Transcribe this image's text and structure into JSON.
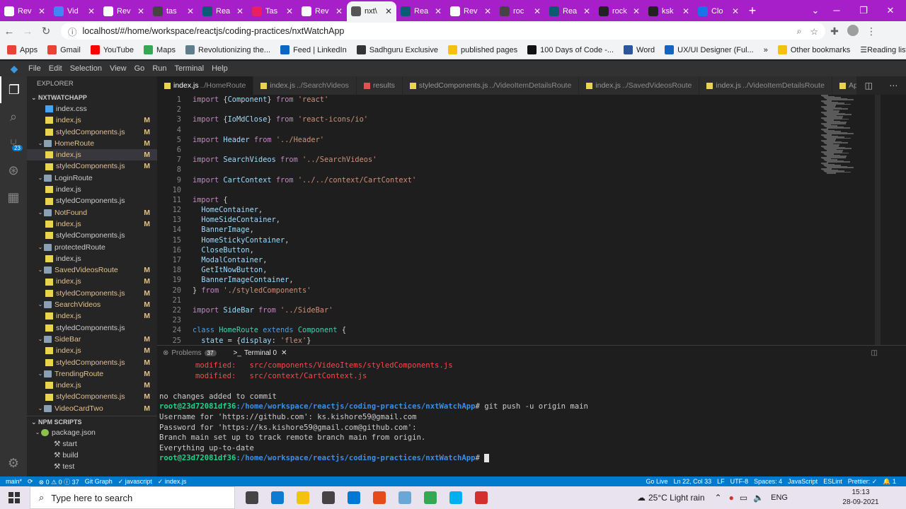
{
  "browser": {
    "tabs": [
      {
        "label": "Rev",
        "color": "#ffffff"
      },
      {
        "label": "Vid",
        "color": "#4285f4"
      },
      {
        "label": "Rev",
        "color": "#ffffff"
      },
      {
        "label": "tas",
        "color": "#444444"
      },
      {
        "label": "Rea",
        "color": "#0b5c73"
      },
      {
        "label": "Tas",
        "color": "#e91e63"
      },
      {
        "label": "Rev",
        "color": "#ffffff"
      },
      {
        "label": "nxt\\",
        "color": "#555555",
        "active": true
      },
      {
        "label": "Rea",
        "color": "#0b5c73"
      },
      {
        "label": "Rev",
        "color": "#ffffff"
      },
      {
        "label": "roc",
        "color": "#444444"
      },
      {
        "label": "Rea",
        "color": "#0b5c73"
      },
      {
        "label": "rock",
        "color": "#222222"
      },
      {
        "label": "ksk",
        "color": "#222222"
      },
      {
        "label": "Clo",
        "color": "#1a73e8"
      }
    ],
    "url": "localhost/#/home/workspace/reactjs/coding-practices/nxtWatchApp",
    "bookmarks": [
      {
        "label": "Apps",
        "color": "#ea4335"
      },
      {
        "label": "Gmail",
        "color": "#ea4335"
      },
      {
        "label": "YouTube",
        "color": "#ff0000"
      },
      {
        "label": "Maps",
        "color": "#34a853"
      },
      {
        "label": "Revolutionizing the...",
        "color": "#607d8b"
      },
      {
        "label": "Feed | LinkedIn",
        "color": "#0a66c2"
      },
      {
        "label": "Sadhguru Exclusive",
        "color": "#333333"
      },
      {
        "label": "published pages",
        "color": "#f4c20d"
      },
      {
        "label": "100 Days of Code -...",
        "color": "#111111"
      },
      {
        "label": "Word",
        "color": "#2b579a"
      },
      {
        "label": "UX/UI Designer (Ful...",
        "color": "#1565c0"
      }
    ],
    "other_bookmarks": "Other bookmarks",
    "reading_list": "Reading list",
    "more": "»"
  },
  "vscode": {
    "menu": [
      "File",
      "Edit",
      "Selection",
      "View",
      "Go",
      "Run",
      "Terminal",
      "Help"
    ],
    "explorer_title": "EXPLORER",
    "project": "NXTWATCHAPP",
    "scm_badge": "23",
    "tree": [
      {
        "label": "index.css",
        "type": "css",
        "indent": 2,
        "m": ""
      },
      {
        "label": "index.js",
        "type": "js",
        "indent": 2,
        "m": "M"
      },
      {
        "label": "styledComponents.js",
        "type": "js",
        "indent": 2,
        "m": "M"
      },
      {
        "label": "HomeRoute",
        "type": "folder",
        "indent": 1,
        "m": "M"
      },
      {
        "label": "index.js",
        "type": "js",
        "indent": 2,
        "m": "M",
        "selected": true
      },
      {
        "label": "styledComponents.js",
        "type": "js",
        "indent": 2,
        "m": "M"
      },
      {
        "label": "LoginRoute",
        "type": "folder",
        "indent": 1,
        "m": ""
      },
      {
        "label": "index.js",
        "type": "js",
        "indent": 2,
        "m": ""
      },
      {
        "label": "styledComponents.js",
        "type": "js",
        "indent": 2,
        "m": ""
      },
      {
        "label": "NotFound",
        "type": "folder",
        "indent": 1,
        "m": "M"
      },
      {
        "label": "index.js",
        "type": "js",
        "indent": 2,
        "m": "M"
      },
      {
        "label": "styledComponents.js",
        "type": "js",
        "indent": 2,
        "m": ""
      },
      {
        "label": "protectedRoute",
        "type": "folder",
        "indent": 1,
        "m": ""
      },
      {
        "label": "index.js",
        "type": "js",
        "indent": 2,
        "m": ""
      },
      {
        "label": "SavedVideosRoute",
        "type": "folder",
        "indent": 1,
        "m": "M"
      },
      {
        "label": "index.js",
        "type": "js",
        "indent": 2,
        "m": "M"
      },
      {
        "label": "styledComponents.js",
        "type": "js",
        "indent": 2,
        "m": "M"
      },
      {
        "label": "SearchVideos",
        "type": "folder",
        "indent": 1,
        "m": "M"
      },
      {
        "label": "index.js",
        "type": "js",
        "indent": 2,
        "m": "M"
      },
      {
        "label": "styledComponents.js",
        "type": "js",
        "indent": 2,
        "m": ""
      },
      {
        "label": "SideBar",
        "type": "folder",
        "indent": 1,
        "m": "M"
      },
      {
        "label": "index.js",
        "type": "js",
        "indent": 2,
        "m": "M"
      },
      {
        "label": "styledComponents.js",
        "type": "js",
        "indent": 2,
        "m": "M"
      },
      {
        "label": "TrendingRoute",
        "type": "folder",
        "indent": 1,
        "m": "M"
      },
      {
        "label": "index.js",
        "type": "js",
        "indent": 2,
        "m": "M"
      },
      {
        "label": "styledComponents.js",
        "type": "js",
        "indent": 2,
        "m": "M"
      },
      {
        "label": "VideoCardTwo",
        "type": "folder",
        "indent": 1,
        "m": "M"
      }
    ],
    "npm_title": "NPM SCRIPTS",
    "npm_pkg": "package.json",
    "npm_scripts": [
      "start",
      "build",
      "test"
    ],
    "editor_tabs": [
      {
        "name": "index.js",
        "path": "../HomeRoute",
        "active": true
      },
      {
        "name": "index.js",
        "path": "../SearchVideos"
      },
      {
        "name": "results",
        "path": ""
      },
      {
        "name": "styledComponents.js",
        "path": "../VideoItemDetailsRoute"
      },
      {
        "name": "index.js",
        "path": "../SavedVideosRoute"
      },
      {
        "name": "index.js",
        "path": "../VideoItemDetailsRoute"
      },
      {
        "name": "Ap",
        "path": ""
      }
    ],
    "code_lines": [
      {
        "n": "1",
        "t": [
          [
            "kw2",
            "import "
          ],
          [
            "pun",
            "{"
          ],
          [
            "var",
            "Component"
          ],
          [
            "pun",
            "} "
          ],
          [
            "kw2",
            "from "
          ],
          [
            "str",
            "'react'"
          ]
        ]
      },
      {
        "n": "2",
        "t": []
      },
      {
        "n": "3",
        "t": [
          [
            "kw2",
            "import "
          ],
          [
            "pun",
            "{"
          ],
          [
            "var",
            "IoMdClose"
          ],
          [
            "pun",
            "} "
          ],
          [
            "kw2",
            "from "
          ],
          [
            "str",
            "'react-icons/io'"
          ]
        ]
      },
      {
        "n": "4",
        "t": []
      },
      {
        "n": "5",
        "t": [
          [
            "kw2",
            "import "
          ],
          [
            "var",
            "Header "
          ],
          [
            "kw2",
            "from "
          ],
          [
            "str",
            "'../Header'"
          ]
        ]
      },
      {
        "n": "6",
        "t": []
      },
      {
        "n": "7",
        "t": [
          [
            "kw2",
            "import "
          ],
          [
            "var",
            "SearchVideos "
          ],
          [
            "kw2",
            "from "
          ],
          [
            "str",
            "'../SearchVideos'"
          ]
        ]
      },
      {
        "n": "8",
        "t": []
      },
      {
        "n": "9",
        "t": [
          [
            "kw2",
            "import "
          ],
          [
            "var",
            "CartContext "
          ],
          [
            "kw2",
            "from "
          ],
          [
            "str",
            "'../../context/CartContext'"
          ]
        ]
      },
      {
        "n": "10",
        "t": []
      },
      {
        "n": "11",
        "t": [
          [
            "kw2",
            "import "
          ],
          [
            "pun",
            "{"
          ]
        ]
      },
      {
        "n": "12",
        "t": [
          [
            "var",
            "  HomeContainer"
          ],
          [
            "pun",
            ","
          ]
        ]
      },
      {
        "n": "13",
        "t": [
          [
            "var",
            "  HomeSideContainer"
          ],
          [
            "pun",
            ","
          ]
        ]
      },
      {
        "n": "14",
        "t": [
          [
            "var",
            "  BannerImage"
          ],
          [
            "pun",
            ","
          ]
        ]
      },
      {
        "n": "15",
        "t": [
          [
            "var",
            "  HomeStickyContainer"
          ],
          [
            "pun",
            ","
          ]
        ]
      },
      {
        "n": "16",
        "t": [
          [
            "var",
            "  CloseButton"
          ],
          [
            "pun",
            ","
          ]
        ]
      },
      {
        "n": "17",
        "t": [
          [
            "var",
            "  ModalContainer"
          ],
          [
            "pun",
            ","
          ]
        ]
      },
      {
        "n": "18",
        "t": [
          [
            "var",
            "  GetItNowButton"
          ],
          [
            "pun",
            ","
          ]
        ]
      },
      {
        "n": "19",
        "t": [
          [
            "var",
            "  BannerImageContainer"
          ],
          [
            "pun",
            ","
          ]
        ]
      },
      {
        "n": "20",
        "t": [
          [
            "pun",
            "} "
          ],
          [
            "kw2",
            "from "
          ],
          [
            "str",
            "'./styledComponents'"
          ]
        ]
      },
      {
        "n": "21",
        "t": []
      },
      {
        "n": "22",
        "t": [
          [
            "kw2",
            "import "
          ],
          [
            "var",
            "SideBar "
          ],
          [
            "kw2",
            "from "
          ],
          [
            "str",
            "'../SideBar'"
          ]
        ]
      },
      {
        "n": "23",
        "t": []
      },
      {
        "n": "24",
        "t": [
          [
            "kw",
            "class "
          ],
          [
            "cls",
            "HomeRoute "
          ],
          [
            "kw",
            "extends "
          ],
          [
            "cls",
            "Component "
          ],
          [
            "pun",
            "{"
          ]
        ]
      },
      {
        "n": "25",
        "t": [
          [
            "var",
            "  state "
          ],
          [
            "pun",
            "= {"
          ],
          [
            "var",
            "display"
          ],
          [
            "pun",
            ": "
          ],
          [
            "str",
            "'flex'"
          ],
          [
            "pun",
            "}"
          ]
        ]
      }
    ],
    "panel_tabs": {
      "problems": "Problems",
      "problems_count": "37",
      "terminal": "Terminal 0"
    },
    "terminal_lines": [
      {
        "kind": "red",
        "text": "        modified:   src/components/VideoItems/styledComponents.js"
      },
      {
        "kind": "red",
        "text": "        modified:   src/context/CartContext.js"
      },
      {
        "kind": "plain",
        "text": ""
      },
      {
        "kind": "plain",
        "text": "no changes added to commit"
      },
      {
        "kind": "prompt",
        "user": "root@23d72081df36",
        "path": ":/home/workspace/reactjs/coding-practices/nxtWatchApp",
        "cmd": "# git push -u origin main"
      },
      {
        "kind": "plain",
        "text": "Username for 'https://github.com': ks.kishore59@gmail.com"
      },
      {
        "kind": "plain",
        "text": "Password for 'https://ks.kishore59@gmail.com@github.com':"
      },
      {
        "kind": "plain",
        "text": "Branch main set up to track remote branch main from origin."
      },
      {
        "kind": "plain",
        "text": "Everything up-to-date"
      },
      {
        "kind": "prompt",
        "user": "root@23d72081df36",
        "path": ":/home/workspace/reactjs/coding-practices/nxtWatchApp",
        "cmd": "# ",
        "cursor": true
      }
    ],
    "status_left": [
      "main*",
      "⟳",
      "⊗ 0 ⚠ 0 ⓘ 37",
      "Git Graph",
      "✓ javascript",
      "✓ index.js"
    ],
    "status_right": [
      "Go Live",
      "Ln 22, Col 33",
      "LF",
      "UTF-8",
      "Spaces: 4",
      "JavaScript",
      "ESLint",
      "Prettier: ✓",
      "🔔 1"
    ]
  },
  "taskbar": {
    "search_placeholder": "Type here to search",
    "weather": "25°C  Light rain",
    "lang": "ENG",
    "time": "15:13",
    "date": "28-09-2021",
    "apps": [
      {
        "name": "task-view-icon",
        "color": "#444444"
      },
      {
        "name": "edge-icon",
        "color": "#0c7bd1"
      },
      {
        "name": "file-explorer-icon",
        "color": "#f4c20d"
      },
      {
        "name": "store-icon",
        "color": "#444444"
      },
      {
        "name": "mail-icon",
        "color": "#0078d4"
      },
      {
        "name": "office-icon",
        "color": "#e64a19"
      },
      {
        "name": "app-icon",
        "color": "#6aa6d6"
      },
      {
        "name": "chrome-icon",
        "color": "#34a853"
      },
      {
        "name": "skype-icon",
        "color": "#00aff0"
      },
      {
        "name": "recorder-icon",
        "color": "#d32f2f"
      }
    ]
  }
}
